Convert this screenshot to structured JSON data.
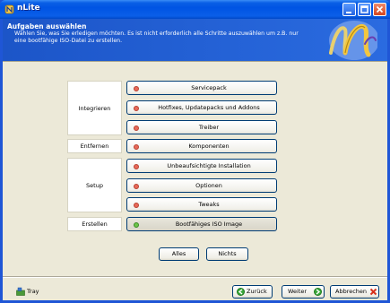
{
  "window": {
    "title": "nLite"
  },
  "header": {
    "title": "Aufgaben auswählen",
    "description": "Wählen Sie, was Sie erledigen möchten. Es ist nicht erforderlich alle Schritte auszuwählen um z.B. nur eine bootfähige ISO-Datei zu erstellen."
  },
  "groups": {
    "integrate": "Integrieren",
    "remove": "Entfernen",
    "setup": "Setup",
    "create": "Erstellen"
  },
  "tasks": {
    "servicepack": "Servicepack",
    "hotfixes": "Hotfixes, Updatepacks und Addons",
    "drivers": "Treiber",
    "components": "Komponenten",
    "unattended": "Unbeaufsichtigte Installation",
    "options": "Optionen",
    "tweaks": "Tweaks",
    "iso": "Bootfähiges ISO Image"
  },
  "selection": {
    "all": "Alles",
    "none": "Nichts"
  },
  "footer": {
    "tray": "Tray",
    "back": "Zurück",
    "next": "Weiter",
    "cancel": "Abbrechen"
  },
  "colors": {
    "titlebar": "#0054e3",
    "task_dot_inactive": "#e86a5a",
    "task_dot_active": "#6cc44a",
    "face": "#ece9d8"
  }
}
